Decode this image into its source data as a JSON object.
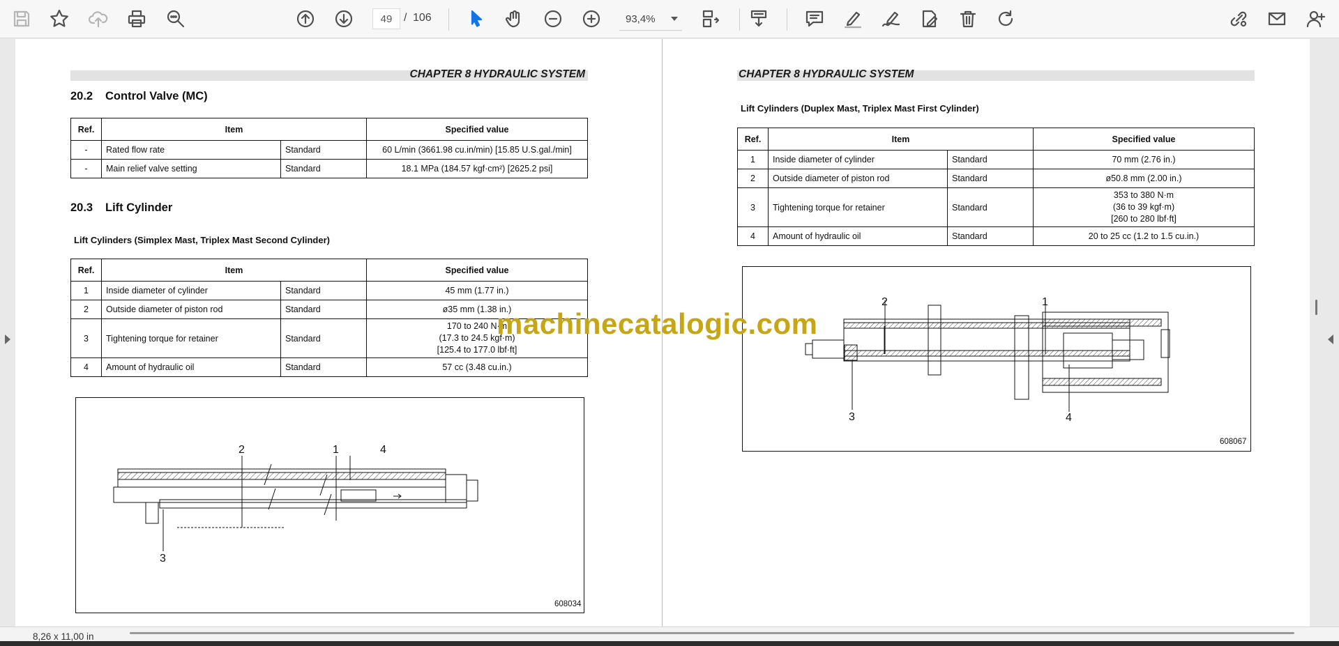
{
  "toolbar": {
    "page_current": "49",
    "page_separator": "/",
    "page_total": "106",
    "zoom": "93,4%"
  },
  "icons": [
    "save-icon",
    "star-icon",
    "cloud-upload-icon",
    "print-icon",
    "zoom-search-icon",
    "page-up-icon",
    "page-down-icon",
    "select-cursor-icon",
    "hand-icon",
    "zoom-out-icon",
    "zoom-in-icon",
    "fit-page-icon",
    "scroll-mode-icon",
    "comment-icon",
    "highlight-pen-icon",
    "sign-icon",
    "fill-sign-icon",
    "trash-icon",
    "redo-icon",
    "share-link-icon",
    "mail-icon",
    "add-user-icon"
  ],
  "colors": {
    "accent": "#1473e6",
    "watermark": "#c6a615"
  },
  "left_page": {
    "chapter": "CHAPTER 8 HYDRAULIC SYSTEM",
    "section1": {
      "num": "20.2",
      "title": "Control Valve (MC)"
    },
    "table1": {
      "headers": [
        "Ref.",
        "Item",
        "Specified value"
      ],
      "rows": [
        {
          "ref": "-",
          "item": "Rated flow rate",
          "cond": "Standard",
          "value": "60 L/min (3661.98 cu.in/min) [15.85 U.S.gal./min]"
        },
        {
          "ref": "-",
          "item": "Main relief valve setting",
          "cond": "Standard",
          "value": "18.1 MPa (184.57 kgf·cm²) [2625.2 psi]"
        }
      ]
    },
    "section2": {
      "num": "20.3",
      "title": "Lift Cylinder"
    },
    "caption2": "Lift Cylinders (Simplex Mast, Triplex Mast Second Cylinder)",
    "table2": {
      "headers": [
        "Ref.",
        "Item",
        "Specified value"
      ],
      "rows": [
        {
          "ref": "1",
          "item": "Inside diameter of cylinder",
          "cond": "Standard",
          "value": "45 mm (1.77 in.)"
        },
        {
          "ref": "2",
          "item": "Outside diameter of piston rod",
          "cond": "Standard",
          "value": "ø35 mm (1.38 in.)"
        },
        {
          "ref": "3",
          "item": "Tightening torque for retainer",
          "cond": "Standard",
          "value1": "170 to 240 N·m",
          "value2": "(17.3 to 24.5 kgf·m)",
          "value3": "[125.4 to 177.0 lbf·ft]"
        },
        {
          "ref": "4",
          "item": "Amount of hydraulic oil",
          "cond": "Standard",
          "value": "57 cc (3.48 cu.in.)"
        }
      ]
    },
    "figure": {
      "labels": [
        "2",
        "1",
        "4",
        "3"
      ],
      "number": "608034"
    }
  },
  "right_page": {
    "chapter": "CHAPTER 8 HYDRAULIC SYSTEM",
    "caption": "Lift Cylinders (Duplex Mast, Triplex Mast First Cylinder)",
    "table": {
      "headers": [
        "Ref.",
        "Item",
        "Specified value"
      ],
      "rows": [
        {
          "ref": "1",
          "item": "Inside diameter of cylinder",
          "cond": "Standard",
          "value": "70 mm (2.76 in.)"
        },
        {
          "ref": "2",
          "item": "Outside diameter of piston rod",
          "cond": "Standard",
          "value": "ø50.8 mm (2.00 in.)"
        },
        {
          "ref": "3",
          "item": "Tightening torque for retainer",
          "cond": "Standard",
          "value1": "353 to 380 N·m",
          "value2": "(36 to 39 kgf·m)",
          "value3": "[260 to 280 lbf·ft]"
        },
        {
          "ref": "4",
          "item": "Amount of hydraulic oil",
          "cond": "Standard",
          "value": "20 to 25 cc (1.2 to 1.5 cu.in.)"
        }
      ]
    },
    "figure": {
      "labels": [
        "2",
        "1",
        "3",
        "4"
      ],
      "number": "608067"
    }
  },
  "watermark": "machinecatalogic.com",
  "status": {
    "dimensions": "8,26 x 11,00 in"
  }
}
